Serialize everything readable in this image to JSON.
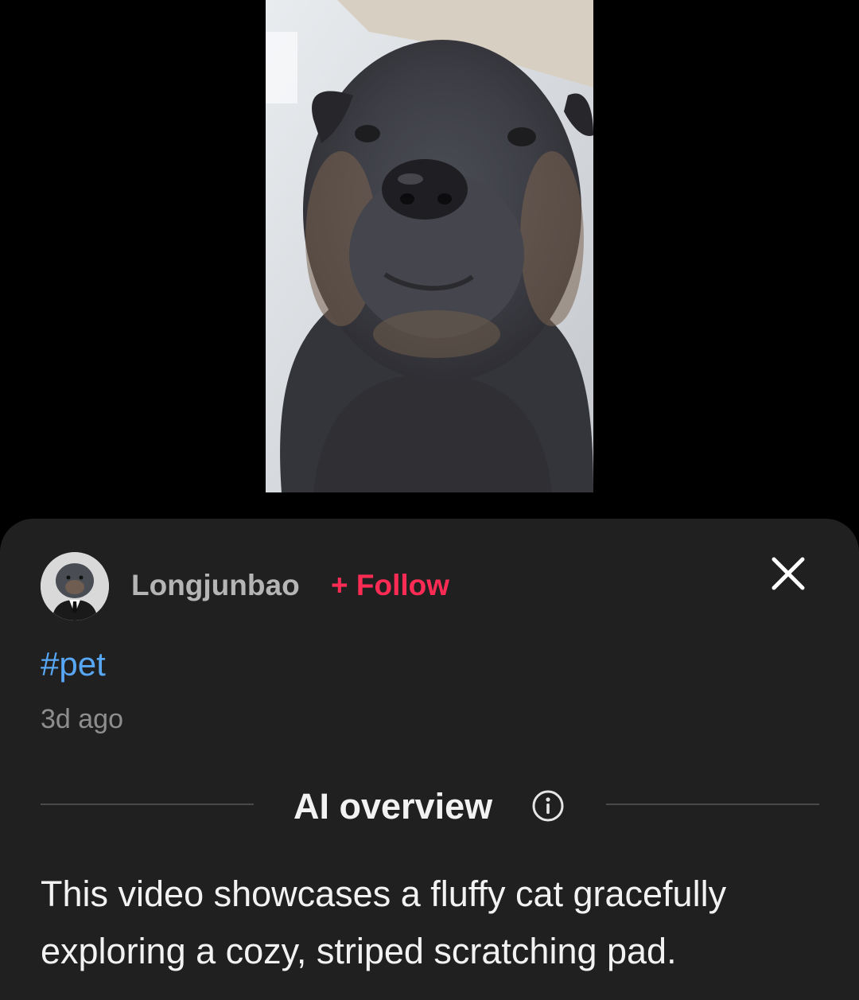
{
  "post": {
    "username": "Longjunbao",
    "follow_label": "+ Follow",
    "hashtag": "#pet",
    "time": "3d ago"
  },
  "ai_overview": {
    "title": "AI overview",
    "summary": "This video showcases a fluffy cat gracefully exploring a cozy, striped scratching pad."
  },
  "icons": {
    "close": "close-icon",
    "info": "info-icon"
  },
  "colors": {
    "sheet_background": "#202020",
    "follow": "#fe2c55",
    "hashtag": "#58a7f5"
  }
}
